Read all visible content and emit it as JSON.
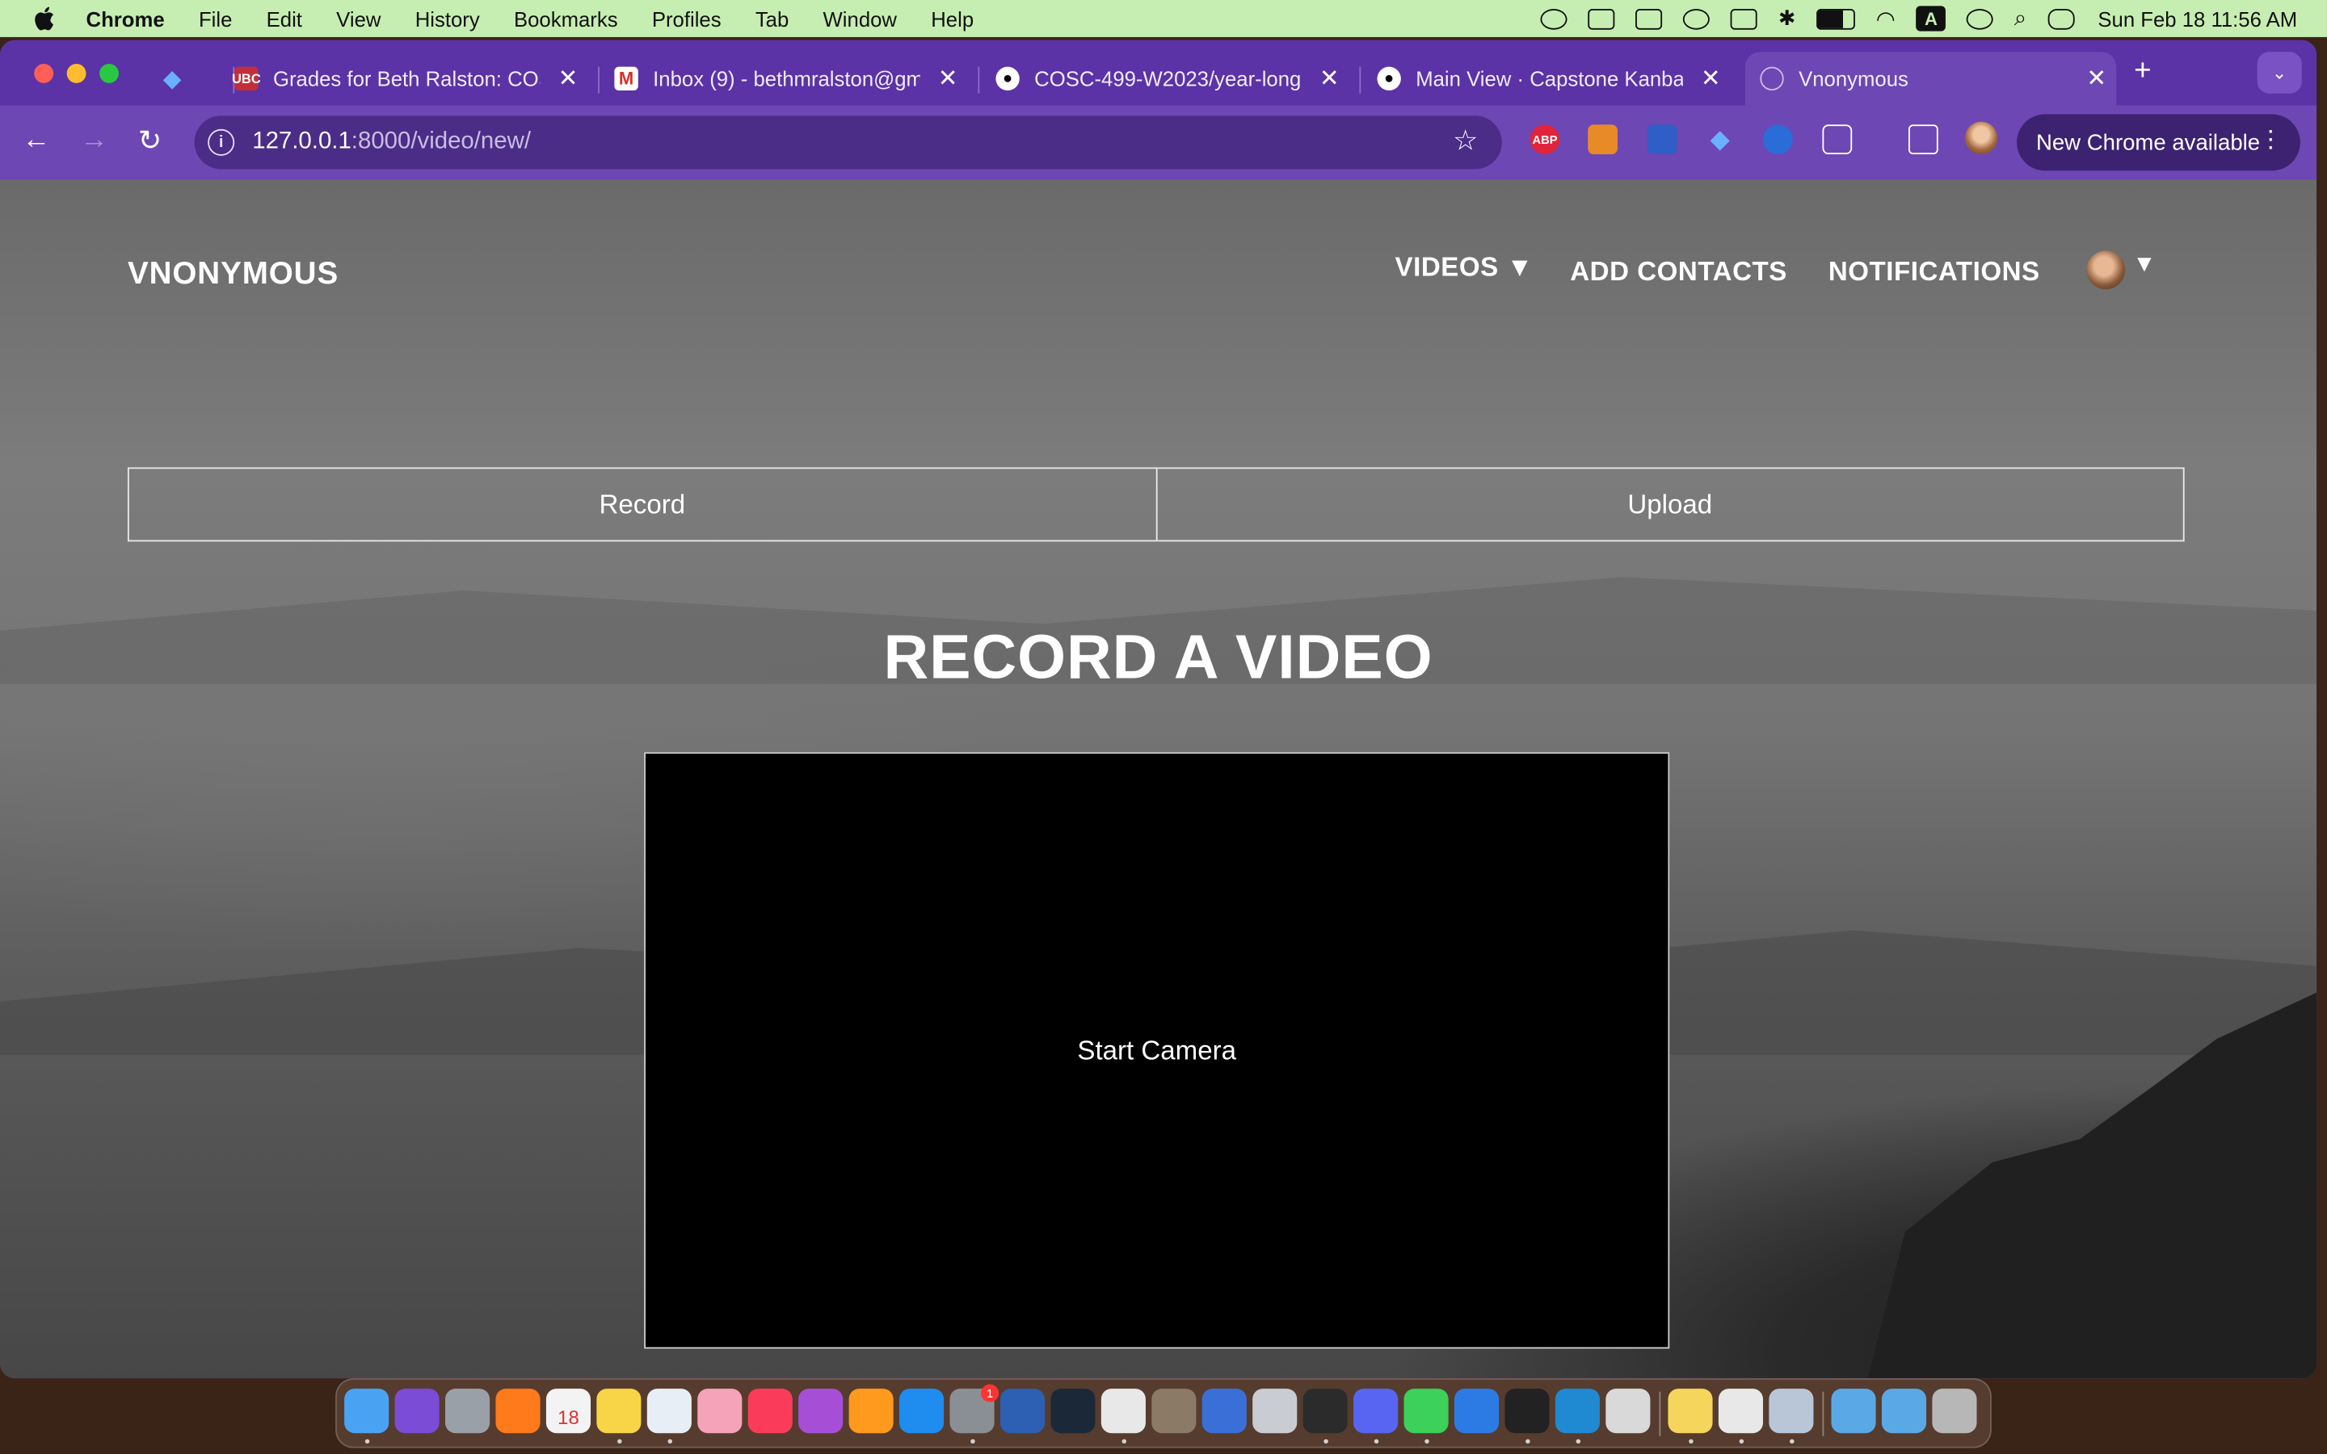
{
  "menubar": {
    "app": "Chrome",
    "items": [
      "File",
      "Edit",
      "View",
      "History",
      "Bookmarks",
      "Profiles",
      "Tab",
      "Window",
      "Help"
    ],
    "keyboard_indicator": "A",
    "datetime": "Sun Feb 18  11:56 AM"
  },
  "browser": {
    "tabs": [
      {
        "title": "",
        "icon": "gem-icon"
      },
      {
        "title": "Grades for Beth Ralston: COS",
        "icon": "ubc-canvas-icon",
        "badge": "UBC"
      },
      {
        "title": "Inbox (9) - bethmralston@gm",
        "icon": "gmail-icon"
      },
      {
        "title": "COSC-499-W2023/year-long",
        "icon": "github-icon"
      },
      {
        "title": "Main View · Capstone Kanban",
        "icon": "github-icon"
      },
      {
        "title": "Vnonymous",
        "icon": "globe-icon",
        "active": true
      }
    ],
    "url_host": "127.0.0.1",
    "url_rest": ":8000/video/new/",
    "extensions": [
      {
        "name": "adblock-plus-icon",
        "label": "ABP",
        "color": "#e0243b"
      },
      {
        "name": "metamask-icon",
        "label": "",
        "color": "#e88a27"
      },
      {
        "name": "bitwarden-icon",
        "label": "",
        "color": "#2f5ec6"
      },
      {
        "name": "gem-icon",
        "label": "",
        "color": "#3a8be0"
      },
      {
        "name": "1password-icon",
        "label": "",
        "color": "#2a6cd8"
      }
    ],
    "update_label": "New Chrome available"
  },
  "site": {
    "brand": "VNONYMOUS",
    "nav": {
      "videos": "VIDEOS",
      "videos_caret": "▼",
      "add_contacts": "ADD CONTACTS",
      "notifications": "NOTIFICATIONS",
      "profile_caret": "▼"
    },
    "tabs": {
      "record": "Record",
      "upload": "Upload"
    },
    "heading": "RECORD A VIDEO",
    "video": {
      "start_camera": "Start Camera"
    }
  },
  "colors": {
    "menubar_bg": "#c7eeb2",
    "tabstrip_bg": "#5b33a6",
    "toolbar_bg": "#6d47b4",
    "omnibox_bg": "#4b2c86",
    "video_bg": "#000000"
  },
  "dock": {
    "apps": [
      {
        "name": "finder-icon",
        "color": "#4aa3f2"
      },
      {
        "name": "siri-icon",
        "color": "#7b4cd6"
      },
      {
        "name": "launchpad-icon",
        "color": "#9aa0a8"
      },
      {
        "name": "firefox-icon",
        "color": "#ff7a1a"
      },
      {
        "name": "calendar-icon",
        "color": "#f3f3f3",
        "label": "18"
      },
      {
        "name": "notes-icon",
        "color": "#f8d546"
      },
      {
        "name": "freeform-icon",
        "color": "#e8eef6"
      },
      {
        "name": "photos-icon",
        "color": "#f5a3b8"
      },
      {
        "name": "music-icon",
        "color": "#fa3c5a"
      },
      {
        "name": "podcasts-icon",
        "color": "#a64fd6"
      },
      {
        "name": "books-icon",
        "color": "#ff9a1e"
      },
      {
        "name": "app-store-icon",
        "color": "#1f8cf0"
      },
      {
        "name": "system-settings-icon",
        "color": "#8a8f96",
        "badge": "1"
      },
      {
        "name": "virtualbox-icon",
        "color": "#2d5fb2"
      },
      {
        "name": "steam-icon",
        "color": "#1b2838"
      },
      {
        "name": "chrome-icon",
        "color": "#e8e8e8"
      },
      {
        "name": "gimp-icon",
        "color": "#8a7a66"
      },
      {
        "name": "arc-icon",
        "color": "#3b6fd8"
      },
      {
        "name": "disk-utility-icon",
        "color": "#c9ccd2"
      },
      {
        "name": "final-cut-icon",
        "color": "#2b2b2b"
      },
      {
        "name": "discord-icon",
        "color": "#5865f2"
      },
      {
        "name": "messages-icon",
        "color": "#3bd15a"
      },
      {
        "name": "memory-icon",
        "color": "#2c7be5"
      },
      {
        "name": "terminal-icon",
        "color": "#222222"
      },
      {
        "name": "vscode-icon",
        "color": "#1f8ad2"
      },
      {
        "name": "screenshot-icon",
        "color": "#d9d9d9"
      },
      {
        "name": "stickies-icon",
        "color": "#f6d55c"
      },
      {
        "name": "chrome-2-icon",
        "color": "#e8e8e8"
      },
      {
        "name": "preview-icon",
        "color": "#b9c6d8"
      },
      {
        "name": "downloads-folder-icon",
        "color": "#5aa9e6"
      },
      {
        "name": "applications-folder-icon",
        "color": "#5aa9e6"
      },
      {
        "name": "trash-icon",
        "color": "#b7b7b7"
      }
    ]
  }
}
